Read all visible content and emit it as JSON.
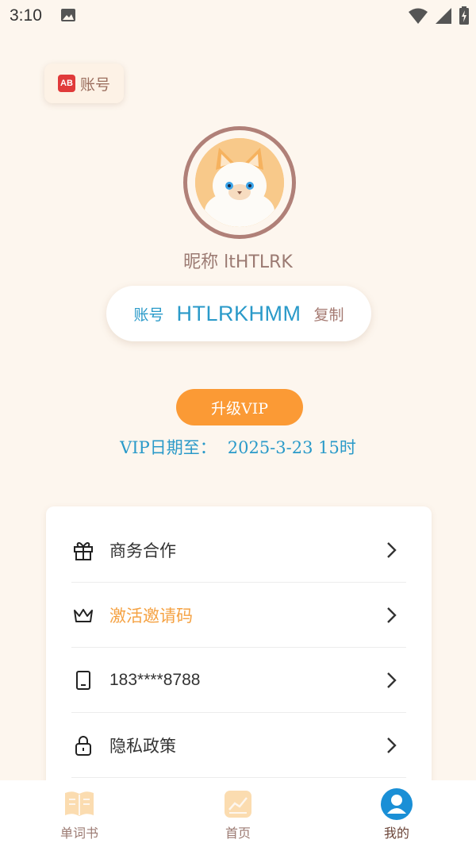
{
  "status_bar": {
    "time": "3:10"
  },
  "account_tag": {
    "icon_text": "AB",
    "label": "账号"
  },
  "profile": {
    "nickname": "昵称 ltHTLRK",
    "account_label": "账号",
    "account_id": "HTLRKHMM",
    "copy_label": "复制"
  },
  "vip": {
    "button_label": "升级VIP",
    "date_label": "VIP日期至：",
    "date_value": "2025-3-23 15时"
  },
  "menu": [
    {
      "icon": "gift-icon",
      "label": "商务合作",
      "color": "#333333"
    },
    {
      "icon": "crown-icon",
      "label": "激活邀请码",
      "color": "#f5a243"
    },
    {
      "icon": "phone-icon",
      "label": "183****8788",
      "color": "#333333"
    },
    {
      "icon": "lock-icon",
      "label": "隐私政策",
      "color": "#333333"
    }
  ],
  "nav": [
    {
      "icon": "book-icon",
      "label": "单词书",
      "active": false
    },
    {
      "icon": "chart-icon",
      "label": "首页",
      "active": false
    },
    {
      "icon": "user-icon",
      "label": "我的",
      "active": true
    }
  ],
  "colors": {
    "accent_blue": "#2a9ac9",
    "accent_orange": "#fb9a35",
    "background": "#fdf6ee"
  }
}
